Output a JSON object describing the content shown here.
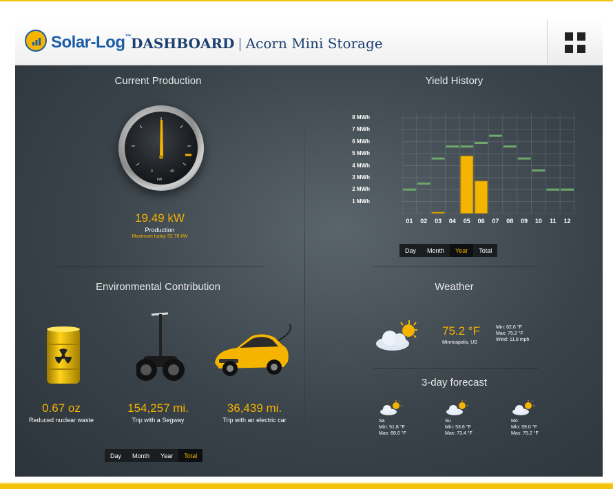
{
  "header": {
    "logo_text": "Solar-Log",
    "logo_tm": "™",
    "title_bold": "DASHBOARD",
    "title_sep": "|",
    "title_sub": "Acorn Mini Storage"
  },
  "current_production": {
    "title": "Current Production",
    "gauge_ticks": [
      "0",
      "40"
    ],
    "gauge_unit": "kW",
    "value": "19.49 kW",
    "label": "Production",
    "max_today": "Maximum today 32.78 kW"
  },
  "yield_history": {
    "title": "Yield History",
    "buttons": [
      "Day",
      "Month",
      "Year",
      "Total"
    ],
    "active_button": "Year"
  },
  "chart_data": {
    "type": "bar",
    "title": "Yield History",
    "categories": [
      "01",
      "02",
      "03",
      "04",
      "05",
      "06",
      "07",
      "08",
      "09",
      "10",
      "11",
      "12"
    ],
    "y_tick_labels": [
      "8 MWh",
      "7 MWh",
      "6 MWh",
      "5 MWh",
      "4 MWh",
      "3 MWh",
      "2 MWh",
      "1 MWh"
    ],
    "ylim": [
      0,
      8
    ],
    "unit": "MWh",
    "series": [
      {
        "values": [
          0,
          0,
          0.1,
          0,
          4.8,
          2.7,
          0,
          0,
          0,
          0,
          0,
          0
        ]
      },
      {
        "values": [
          2.0,
          2.5,
          4.6,
          5.6,
          5.6,
          5.9,
          6.5,
          5.6,
          4.6,
          3.6,
          2.0,
          2.0
        ]
      }
    ],
    "colors": [
      "#f4b400",
      "#6fa86b"
    ]
  },
  "environment": {
    "title": "Environmental Contribution",
    "items": [
      {
        "value": "0.67 oz",
        "label": "Reduced nuclear waste",
        "icon": "nuclear-barrel-icon"
      },
      {
        "value": "154,257 mi.",
        "label": "Trip with a Segway",
        "icon": "segway-icon"
      },
      {
        "value": "36,439 mi.",
        "label": "Trip with an electric car",
        "icon": "electric-car-icon"
      }
    ],
    "buttons": [
      "Day",
      "Month",
      "Year",
      "Total"
    ],
    "active_button": "Total"
  },
  "weather": {
    "title": "Weather",
    "temp": "75.2 °F",
    "location": "Minneapolis, US",
    "min": "Min: 62.6 °F",
    "max": "Max: 75.2 °F",
    "wind": "Wind: 11.8 mph",
    "icon": "partly-cloudy-icon",
    "forecast_title": "3-day forecast",
    "forecast": [
      {
        "day": "Sa",
        "min": "Min: 51.8 °F",
        "max": "Max: 68.0 °F"
      },
      {
        "day": "Su",
        "min": "Min: 53.6 °F",
        "max": "Max: 73.4 °F"
      },
      {
        "day": "Mo",
        "min": "Min: 59.0 °F",
        "max": "Max: 75.2 °F"
      }
    ]
  },
  "colors": {
    "accent": "#f4b400",
    "brand_blue": "#1b5ea7",
    "panel": "#3a434a"
  }
}
